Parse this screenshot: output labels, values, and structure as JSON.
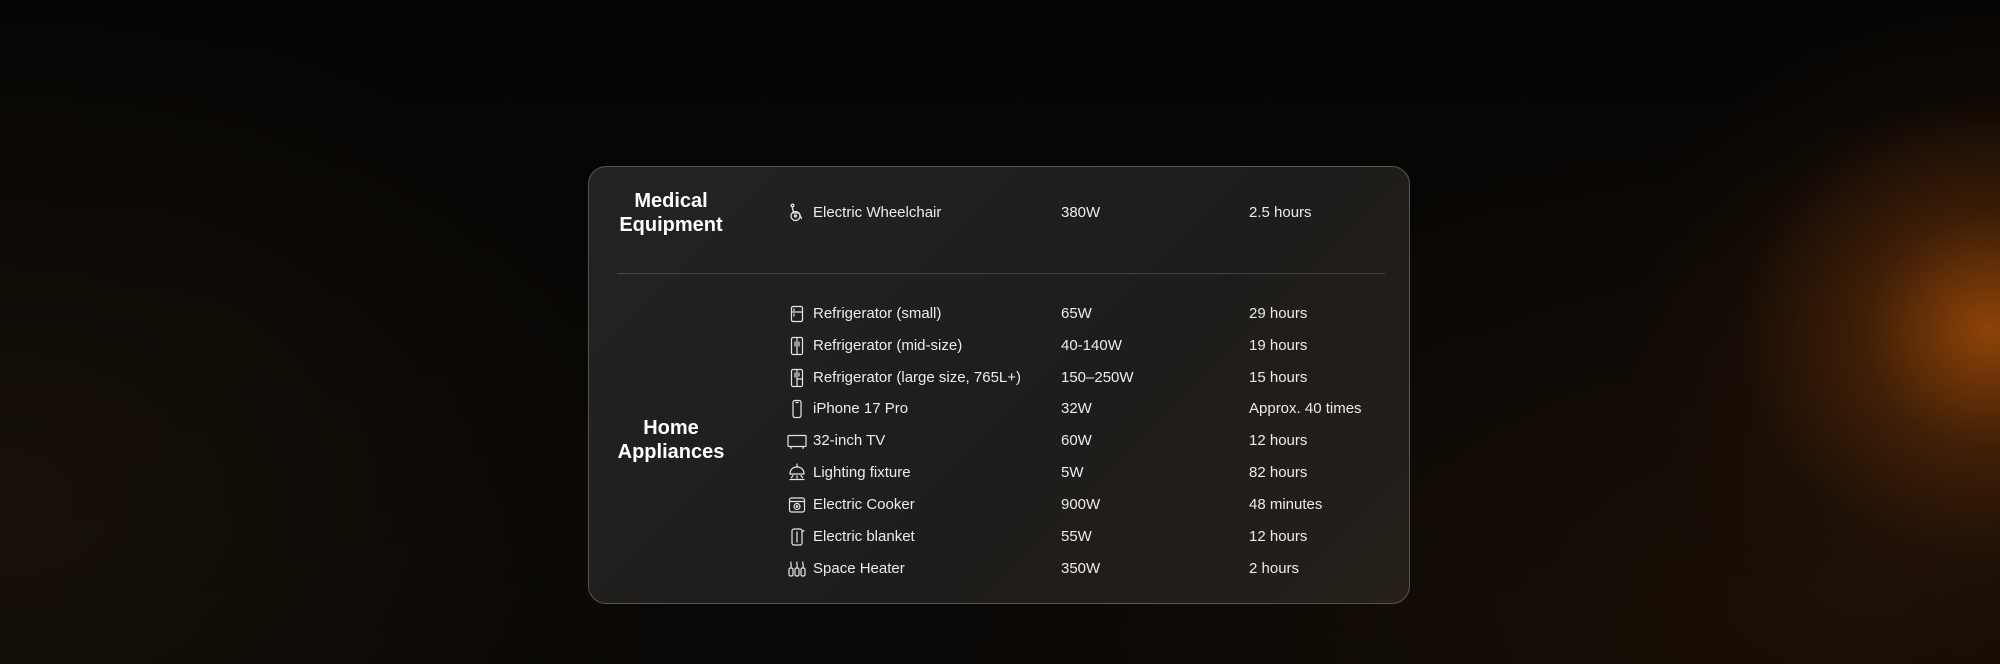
{
  "sections": [
    {
      "category": [
        "Medical",
        "Equipment"
      ],
      "items": [
        {
          "icon": "wheelchair-icon",
          "name": "Electric Wheelchair",
          "power": "380W",
          "runtime": "2.5 hours"
        }
      ]
    },
    {
      "category": [
        "Home",
        "Appliances"
      ],
      "items": [
        {
          "icon": "refrigerator-small-icon",
          "name": "Refrigerator (small)",
          "power": "65W",
          "runtime": "29 hours"
        },
        {
          "icon": "refrigerator-mid-icon",
          "name": "Refrigerator (mid-size)",
          "power": "40-140W",
          "runtime": "19 hours"
        },
        {
          "icon": "refrigerator-large-icon",
          "name": "Refrigerator (large size, 765L+)",
          "power": "150–250W",
          "runtime": "15 hours"
        },
        {
          "icon": "smartphone-icon",
          "name": "iPhone 17 Pro",
          "power": "32W",
          "runtime": "Approx. 40 times"
        },
        {
          "icon": "tv-icon",
          "name": "32-inch TV",
          "power": "60W",
          "runtime": "12 hours"
        },
        {
          "icon": "ceiling-lamp-icon",
          "name": "Lighting fixture",
          "power": "5W",
          "runtime": "82 hours"
        },
        {
          "icon": "rice-cooker-icon",
          "name": "Electric Cooker",
          "power": "900W",
          "runtime": "48 minutes"
        },
        {
          "icon": "electric-blanket-icon",
          "name": "Electric blanket",
          "power": "55W",
          "runtime": "12 hours"
        },
        {
          "icon": "space-heater-icon",
          "name": "Space Heater",
          "power": "350W",
          "runtime": "2 hours"
        }
      ]
    }
  ],
  "colors": {
    "text": "#ececec",
    "heading": "#ffffff",
    "accent_glow": "#a54e08"
  }
}
